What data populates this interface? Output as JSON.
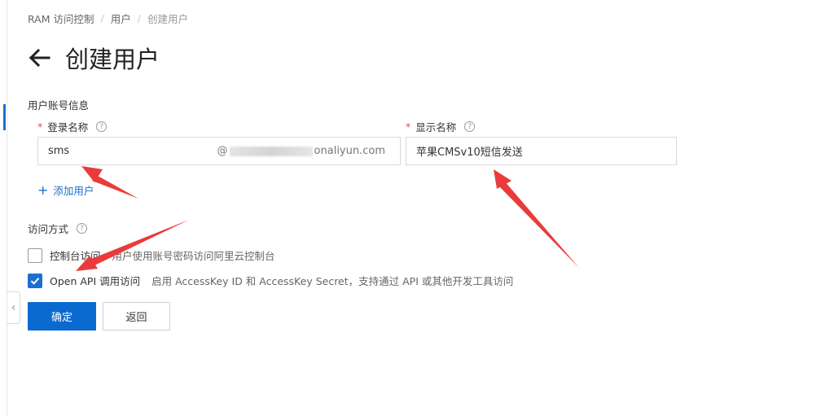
{
  "breadcrumb": {
    "root": "RAM 访问控制",
    "sep1": "/",
    "middle": "用户",
    "sep2": "/",
    "current": "创建用户"
  },
  "page": {
    "title": "创建用户"
  },
  "account_section": {
    "heading": "用户账号信息",
    "login_name": {
      "required_mark": "*",
      "label": "登录名称",
      "value": "sms",
      "suffix_prefix": "@",
      "suffix_domain": "onaliyun.com"
    },
    "display_name": {
      "required_mark": "*",
      "label": "显示名称",
      "value": "苹果CMSv10短信发送"
    },
    "add_user": {
      "plus": "+",
      "label": "添加用户"
    }
  },
  "access_section": {
    "heading": "访问方式",
    "console": {
      "label": "控制台访问",
      "desc": "用户使用账号密码访问阿里云控制台",
      "checked": false
    },
    "openapi": {
      "label": "Open API 调用访问",
      "desc": "启用 AccessKey ID 和 AccessKey Secret，支持通过 API 或其他开发工具访问",
      "checked": true
    }
  },
  "buttons": {
    "confirm": "确定",
    "back": "返回"
  },
  "icons": {
    "help": "?",
    "collapse": "‹"
  },
  "colors": {
    "primary": "#0b6ad0",
    "link": "#1a6fd1",
    "required": "#e34d4d",
    "annotation_arrow": "#ea3b3b"
  }
}
